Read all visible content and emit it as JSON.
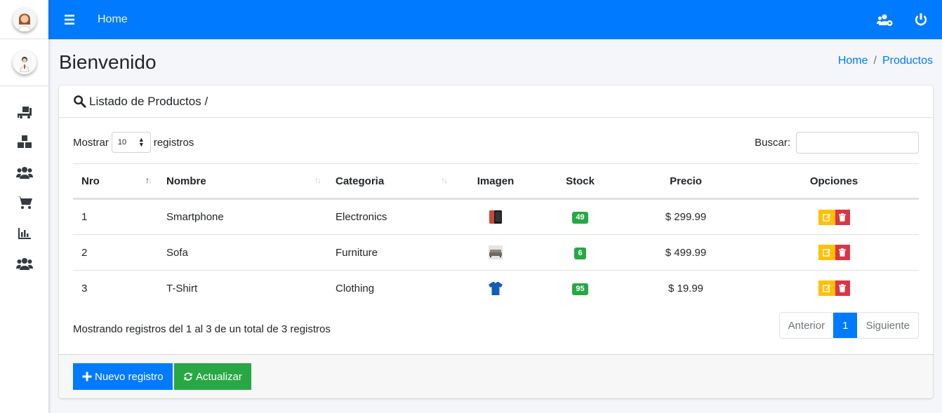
{
  "topbar": {
    "home_label": "Home"
  },
  "header": {
    "title": "Bienvenido",
    "breadcrumb": [
      "Home",
      "Productos"
    ]
  },
  "card": {
    "title": "Listado de Productos /",
    "length_prefix": "Mostrar",
    "length_value": "10",
    "length_suffix": "registros",
    "search_label": "Buscar:",
    "search_value": "",
    "columns": [
      "Nro",
      "Nombre",
      "Categoria",
      "Imagen",
      "Stock",
      "Precio",
      "Opciones"
    ],
    "rows": [
      {
        "nro": "1",
        "nombre": "Smartphone",
        "categoria": "Electronics",
        "image_icon": "smartphone-icon",
        "stock": "49",
        "precio": "$ 299.99"
      },
      {
        "nro": "2",
        "nombre": "Sofa",
        "categoria": "Furniture",
        "image_icon": "sofa-icon",
        "stock": "6",
        "precio": "$ 499.99"
      },
      {
        "nro": "3",
        "nombre": "T-Shirt",
        "categoria": "Clothing",
        "image_icon": "tshirt-icon",
        "stock": "95",
        "precio": "$ 19.99"
      }
    ],
    "info": "Mostrando registros del 1 al 3 de un total de 3 registros",
    "pagination": {
      "prev": "Anterior",
      "current": "1",
      "next": "Siguiente"
    },
    "buttons": {
      "new": "Nuevo registro",
      "refresh": "Actualizar"
    }
  },
  "sidebar": {
    "icons": [
      "truck-loading-icon",
      "boxes-icon",
      "users-icon",
      "cart-icon",
      "chart-bar-icon",
      "users-icon"
    ]
  },
  "colors": {
    "primary": "#007bff",
    "success": "#28a745",
    "warning": "#ffc107",
    "danger": "#dc3545"
  }
}
